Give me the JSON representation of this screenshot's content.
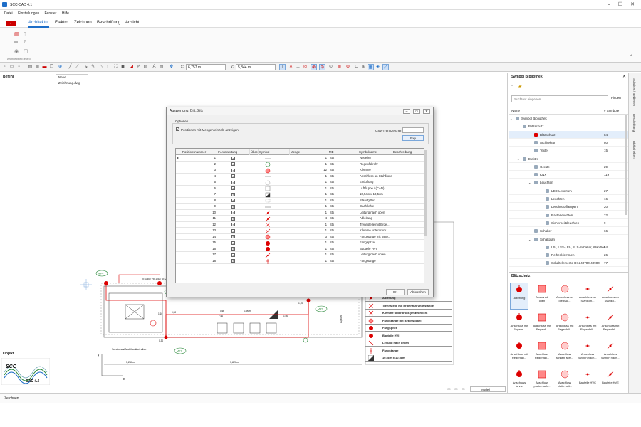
{
  "window": {
    "title": "SCC-CAD 4.1"
  },
  "menu": [
    "Datei",
    "Einstellungen",
    "Fenster",
    "Hilfe"
  ],
  "ribbon": {
    "tabs": [
      "Architektur",
      "Elektro",
      "Zeichnen",
      "Beschriftung",
      "Ansicht"
    ],
    "active": 0,
    "group_label": "Architektur Elektro"
  },
  "toolbar": {
    "x_label": "x:",
    "x_value": "6,757 m",
    "y_label": "y:",
    "y_value": "5,844 m"
  },
  "left": {
    "befehl_title": "Befehl",
    "objekt_title": "Objekt",
    "logo_text": "SCC",
    "logo_sub": "CAD 4.1"
  },
  "document": {
    "tab": "Neue Zeichnung.dwg",
    "model_select": "Modell"
  },
  "drawing": {
    "labels": {
      "mp4": "MP4",
      "mp3": "MP3",
      "mp2": "MP2",
      "mp1": "MP1",
      "cable": "VI: 3,50 / VII: 1,40 / VI: 2,00 m",
      "h1": "1,10",
      "h2": "0,50",
      "h3": "0,60",
      "h4": "7,60",
      "h5": "1,90m",
      "h6": "1,10",
      "h7": "1,60",
      "h8": "0,30",
      "h9": "10,80m",
      "station": "Sendemast Mobilfunkbetreiber",
      "dim1": "3,260m",
      "dim2": "7,820m",
      "axis_y": "y",
      "axis_x": "x"
    },
    "legend": [
      "Ableitung",
      "Trennstelle mit Erdeinführungsstange",
      "Klemme unterdruck (Im Erdreich)",
      "Fangstange mit Betonsockel",
      "Fangspitze",
      "Bauteile HVI",
      "Leitung nach unten",
      "Fangstange",
      "10,5cm x 10,5cm"
    ]
  },
  "dialog": {
    "title": "Auswertung: Bitt.Blitz",
    "options_label": "Optionen",
    "checkbox_label": "Positionen mit Mengen einzeln anzeigen",
    "csv_label": "CSV-Trennzeichen",
    "csv_value": ";",
    "export_btn": "Exp",
    "ok_btn": "OK",
    "cancel_btn": "Abbrechen",
    "columns": [
      "",
      "Positionsnummer",
      "In Auswertung",
      "Über...",
      "Symbol",
      "Menge",
      "ME",
      "Symbolname",
      "Beschreibung"
    ],
    "rows": [
      {
        "pos": "1",
        "menge": "1",
        "me": "Stk",
        "name": "Notfeiler",
        "sym": "line"
      },
      {
        "pos": "2",
        "menge": "1",
        "me": "Stk",
        "name": "Regenfallrohr",
        "sym": "circle-green"
      },
      {
        "pos": "3",
        "menge": "12",
        "me": "Stk",
        "name": "Klemme",
        "sym": "circle-red"
      },
      {
        "pos": "4",
        "menge": "1",
        "me": "Stk",
        "name": "Anschluss an Stahlkonstruktion",
        "sym": "line"
      },
      {
        "pos": "5",
        "menge": "1",
        "me": "Stk",
        "name": "Entlüftung",
        "sym": "circle"
      },
      {
        "pos": "6",
        "menge": "1",
        "me": "Stk",
        "name": "Luftfluppe / (CAD)",
        "sym": "box"
      },
      {
        "pos": "7",
        "menge": "1",
        "me": "Stk",
        "name": "10,5cm x 10,5cm",
        "sym": "tri"
      },
      {
        "pos": "8",
        "menge": "1",
        "me": "Stk",
        "name": "Standgitter",
        "sym": "grid"
      },
      {
        "pos": "9",
        "menge": "1",
        "me": "Stk",
        "name": "Dachkehle",
        "sym": "line"
      },
      {
        "pos": "10",
        "menge": "1",
        "me": "Stk",
        "name": "Leitung nach oben",
        "sym": "arrow"
      },
      {
        "pos": "11",
        "menge": "4",
        "me": "Stk",
        "name": "Ableitung",
        "sym": "arrow"
      },
      {
        "pos": "12",
        "menge": "1",
        "me": "Stk",
        "name": "Trennstelle mit Erdei...",
        "sym": "cross"
      },
      {
        "pos": "13",
        "menge": "1",
        "me": "Stk",
        "name": "Klemme unterdruck...",
        "sym": "cross"
      },
      {
        "pos": "14",
        "menge": "3",
        "me": "Stk",
        "name": "Fangstange mit Beto...",
        "sym": "circle-red"
      },
      {
        "pos": "15",
        "menge": "1",
        "me": "Stk",
        "name": "Fangspitze",
        "sym": "dot-red"
      },
      {
        "pos": "16",
        "menge": "1",
        "me": "Stk",
        "name": "Bauteile HVI",
        "sym": "dot-red"
      },
      {
        "pos": "17",
        "menge": "1",
        "me": "Stk",
        "name": "Leitung nach unten",
        "sym": "arrow"
      },
      {
        "pos": "18",
        "menge": "1",
        "me": "Stk",
        "name": "Fangstange",
        "sym": "pin"
      }
    ]
  },
  "library": {
    "title": "Symbol Bibliothek",
    "search_placeholder": "Suchtext eingeben...",
    "search_btn": "Finden",
    "col_name": "Name",
    "col_count": "# Symbole",
    "tree": [
      {
        "name": "Symbol Bibliothek",
        "count": "",
        "indent": 8
      },
      {
        "name": "Blitzschutz",
        "count": "",
        "indent": 18
      },
      {
        "name": "Blitzschutz",
        "count": "84",
        "indent": 34,
        "sel": true
      },
      {
        "name": "Architektur",
        "count": "80",
        "indent": 34
      },
      {
        "name": "Texte",
        "count": "15",
        "indent": 34
      },
      {
        "name": "Elektro",
        "count": "",
        "indent": 18
      },
      {
        "name": "Geräte",
        "count": "29",
        "indent": 34
      },
      {
        "name": "KNX",
        "count": "119",
        "indent": 34
      },
      {
        "name": "Leuchten",
        "count": "",
        "indent": 34
      },
      {
        "name": "LED-Leuchten",
        "count": "27",
        "indent": 50
      },
      {
        "name": "Leuchten",
        "count": "16",
        "indent": 50
      },
      {
        "name": "Leuchtstofflampen",
        "count": "20",
        "indent": 50
      },
      {
        "name": "Rasterleuchten",
        "count": "22",
        "indent": 50
      },
      {
        "name": "Sicherheitsleuchten",
        "count": "9",
        "indent": 50
      },
      {
        "name": "Schalter",
        "count": "66",
        "indent": 34
      },
      {
        "name": "Schaltplan",
        "count": "",
        "indent": 34
      },
      {
        "name": "LS-, LSS-, FI-, SLS-Schalter, Wandler",
        "count": "54",
        "indent": 50
      },
      {
        "name": "Reihenklemmen",
        "count": "26",
        "indent": 50
      },
      {
        "name": "Schaltelemente DIN 40700-40900",
        "count": "77",
        "indent": 50
      }
    ],
    "palette_title": "Blitzschutz",
    "palette": [
      "Ableitung",
      "Abspannk ollen",
      "Anschluss an die Bau...",
      "Anschluss an Stahlkon...",
      "Anschluss an Stahlko...",
      "Anschluss mit Regenr...",
      "Anschluss mit Regenf...",
      "Anschluss mit Regenfall...",
      "Anschluss mit Regenfall...",
      "Anschluss mit Regenfall...",
      "Anschluss mit Regenfall...",
      "Anschluss Regenfall...",
      "Anschluss fahnen alter...",
      "Anschluss fahnen nach...",
      "Anschluss fahnen nach...",
      "Anschluss fahne",
      "Anschluss platte nach...",
      "Anschluss platte seit...",
      "Bauteile HVC",
      "Bauteile HVE"
    ]
  },
  "vtabs": [
    "Schalter / Bedienen",
    "Beschriftung",
    "Bibliotheken"
  ],
  "status": {
    "text": "Zeichnen"
  }
}
